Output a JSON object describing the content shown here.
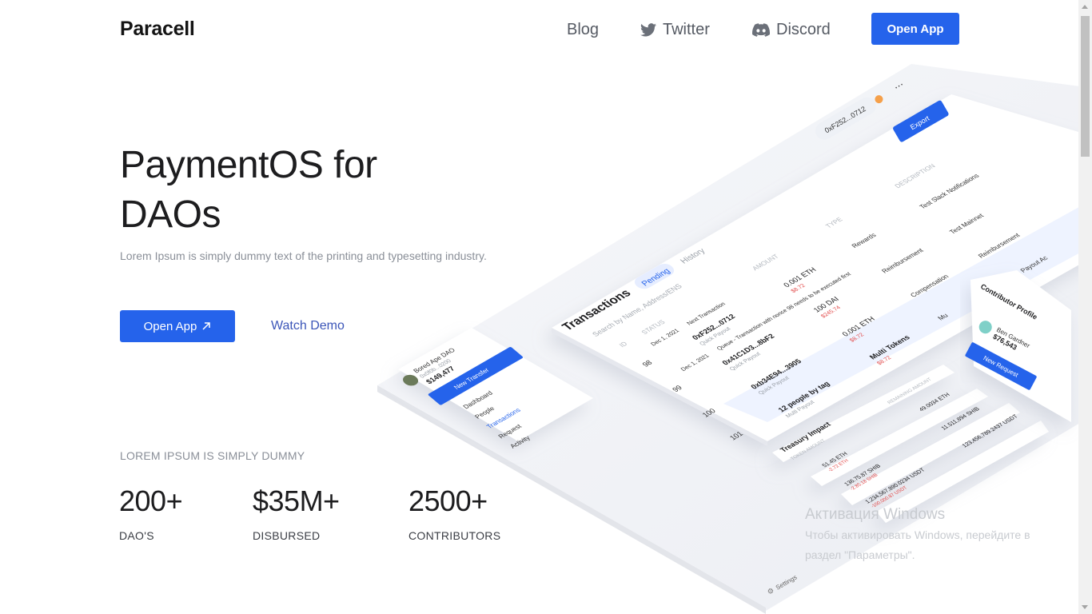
{
  "nav": {
    "logo": "Paracell",
    "links": [
      {
        "label": "Blog",
        "icon": ""
      },
      {
        "label": "Twitter",
        "icon": "twitter-icon"
      },
      {
        "label": "Discord",
        "icon": "discord-icon"
      }
    ],
    "cta": "Open App"
  },
  "hero": {
    "title": "PaymentOS for DAOs",
    "subtitle": "Lorem Ipsum is simply dummy text of the printing and typesetting industry.",
    "primary_cta": "Open App",
    "secondary_cta": "Watch Demo"
  },
  "stats": {
    "kicker": "LOREM IPSUM IS SIMPLY DUMMY",
    "items": [
      {
        "value": "200+",
        "label": "DAO'S"
      },
      {
        "value": "$35M+",
        "label": "DISBURSED"
      },
      {
        "value": "2500+",
        "label": "CONTRIBUTORS"
      }
    ]
  },
  "mockup": {
    "wallet": "0xF252...0712",
    "export": "Export",
    "transactions_title": "Transactions",
    "tabs": [
      "Pending",
      "History"
    ],
    "search_placeholder": "Search by Name, Address/ENS",
    "columns": [
      "ID",
      "STATUS",
      "AMOUNT",
      "TYPE",
      "DESCRIPTION"
    ],
    "rows": [
      {
        "id": "98",
        "date": "Dec 1, 2021",
        "status": "Next Transaction",
        "addr": "0xF252...0712",
        "sub": "Quick Payout",
        "amount": "0.001 ETH",
        "usd": "$8.72",
        "type": "Rewards",
        "desc": "Test Slack Notifications"
      },
      {
        "id": "99",
        "date": "Dec 1, 2021",
        "status": "Queue - Transaction with nonce 98 needs to be executed first",
        "addr": "0x41C1D3...8bF2",
        "sub": "Quick Payout",
        "amount": "100 DAI",
        "usd": "$245.74",
        "type": "Reimbursement",
        "desc": "Test Mainnet"
      },
      {
        "id": "100",
        "date": "",
        "status": "",
        "addr": "0xb34E94...3905",
        "sub": "Quick Payout",
        "amount": "0.001 ETH",
        "usd": "$8.72",
        "type": "Compensation",
        "desc": "Reimbursement"
      },
      {
        "id": "101",
        "date": "",
        "status": "",
        "addr": "12 people by tag",
        "sub": "Multi Payout",
        "amount": "Multi Tokens",
        "usd": "$8.72",
        "type": "Mu",
        "desc": "Mass Payout Ac"
      }
    ],
    "sidebar": {
      "dao_name": "Bored Ape DAO",
      "dao_addr": "0x0f0b...0200",
      "balance": "$149,477",
      "new_transfer": "New Transfer",
      "items": [
        "Dashboard",
        "People",
        "Transactions",
        "Request",
        "Activity"
      ],
      "settings": "Settings"
    },
    "treasury": {
      "title": "Treasury Impact",
      "col1": "TOKEN AMOUNT",
      "col2": "REMAINING AMOUNT",
      "rows": [
        {
          "token": "51.45 ETH",
          "sub": "-2.72 ETH",
          "remaining": "49.0034 ETH"
        },
        {
          "token": "136.75.87 SHIB",
          "sub": "-2.85.18 SHIB",
          "remaining": "11.511,894 SHIB"
        },
        {
          "token": "1,234,567,890.0234 USDT",
          "sub": "-100,000.87 USDT",
          "remaining": "123,456,789.2437 USDT"
        }
      ]
    },
    "profile": {
      "title": "Contributor Profile",
      "name": "Ben Gardner",
      "amount": "$76,543",
      "cta": "New Request"
    }
  },
  "watermark": {
    "title": "Активация Windows",
    "line1": "Чтобы активировать Windows, перейдите в",
    "line2": "раздел \"Параметры\"."
  },
  "colors": {
    "accent": "#2563eb",
    "link": "#3b55b8",
    "muted": "#8a8f98"
  }
}
